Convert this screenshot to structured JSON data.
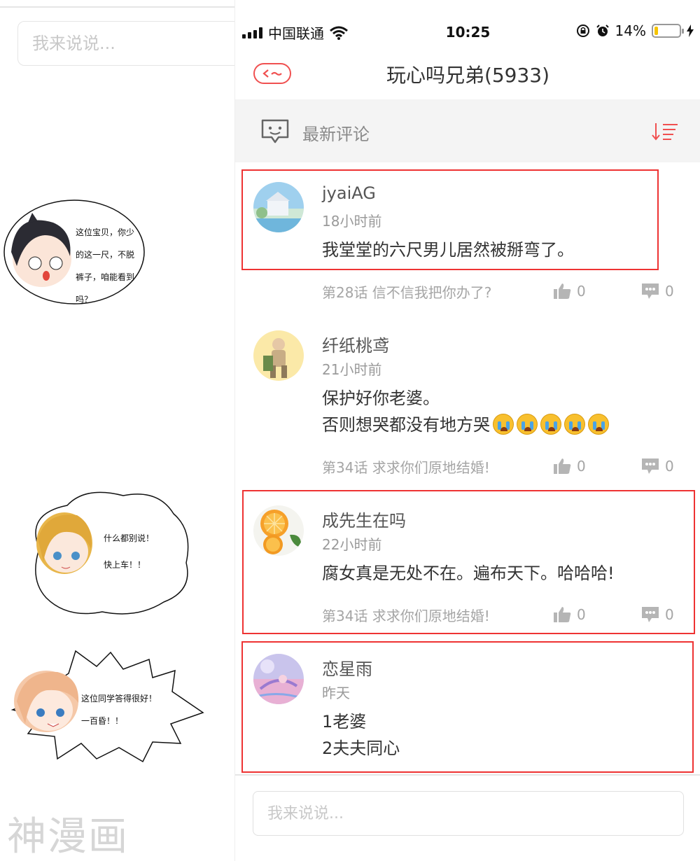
{
  "left_panel": {
    "input_placeholder": "我来说说...",
    "bubble1_lines": [
      "这位宝贝，你少",
      "的这一尺，不脱",
      "裤子，咱能看到",
      "吗？"
    ],
    "bubble2_lines": [
      "什么都别说！",
      "快上车！！"
    ],
    "bubble3_lines": [
      "这位同学答得很好！",
      "一百昏！！"
    ],
    "watermark": "神漫画"
  },
  "status_bar": {
    "carrier": "中国联通",
    "time": "10:25",
    "battery_percent": "14%",
    "battery_level": 0.14
  },
  "nav": {
    "title": "玩心吗兄弟(5933)"
  },
  "sort_bar": {
    "label": "最新评论"
  },
  "comments": [
    {
      "user": "jyaiAG",
      "time": "18小时前",
      "lines": [
        "我堂堂的六尺男儿居然被掰弯了。"
      ],
      "chapter": "第28话 信不信我把你办了?",
      "likes": "0",
      "replies": "0",
      "highlighted": true
    },
    {
      "user": "纤纸桃鸢",
      "time": "21小时前",
      "lines": [
        "保护好你老婆。",
        "否则想哭都没有地方哭"
      ],
      "emoji_count": 5,
      "chapter": "第34话 求求你们原地结婚!",
      "likes": "0",
      "replies": "0",
      "highlighted": false
    },
    {
      "user": "成先生在吗",
      "time": "22小时前",
      "lines": [
        "腐女真是无处不在。遍布天下。哈哈哈!"
      ],
      "chapter": "第34话 求求你们原地结婚!",
      "likes": "0",
      "replies": "0",
      "highlighted": true
    },
    {
      "user": "恋星雨",
      "time": "昨天",
      "lines": [
        "1老婆",
        "2夫夫同心"
      ],
      "highlighted": true
    }
  ],
  "bottom_input": {
    "placeholder": "我来说说..."
  },
  "colors": {
    "accent_red": "#f05050",
    "highlight_box": "#e33333",
    "battery_fill": "#f5c400"
  }
}
